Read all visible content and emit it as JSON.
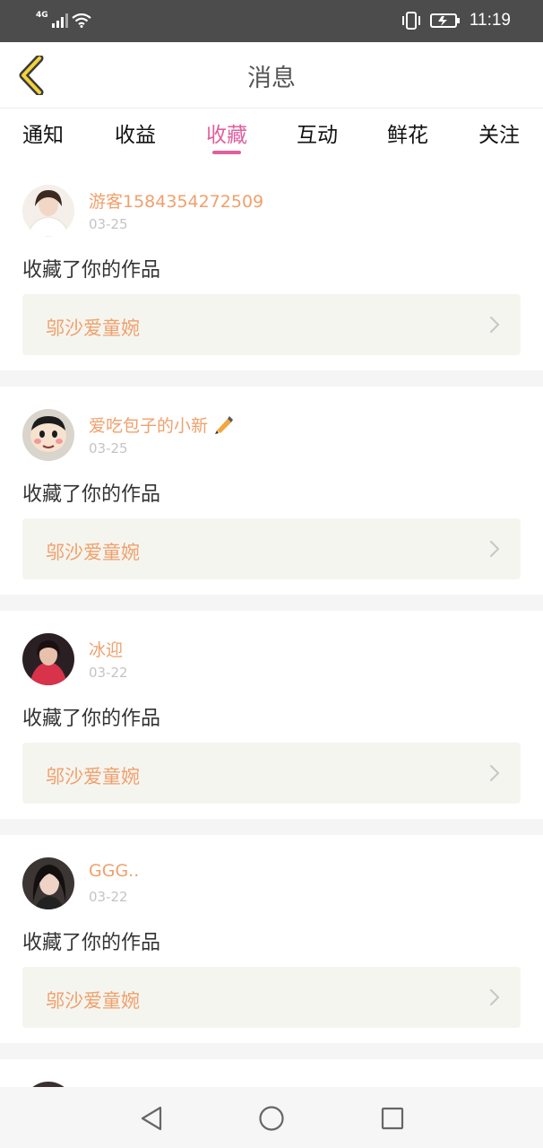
{
  "status_bar": {
    "network_label": "4G",
    "time": "11:19"
  },
  "header": {
    "title": "消息",
    "back_icon": "back-chevron-icon"
  },
  "tabs": [
    {
      "label": "通知",
      "active": false
    },
    {
      "label": "收益",
      "active": false
    },
    {
      "label": "收藏",
      "active": true
    },
    {
      "label": "互动",
      "active": false
    },
    {
      "label": "鲜花",
      "active": false
    },
    {
      "label": "关注",
      "active": false
    }
  ],
  "messages": [
    {
      "user": "游客1584354272509",
      "date": "03-25",
      "action": "收藏了你的作品",
      "work_title": "邬沙爱童婉"
    },
    {
      "user": "爱吃包子的小新",
      "date": "03-25",
      "action": "收藏了你的作品",
      "work_title": "邬沙爱童婉"
    },
    {
      "user": "冰迎",
      "date": "03-22",
      "action": "收藏了你的作品",
      "work_title": "邬沙爱童婉"
    },
    {
      "user": "GGG..",
      "date": "03-22",
      "action": "收藏了你的作品",
      "work_title": "邬沙爱童婉"
    }
  ],
  "colors": {
    "accent": "#e0609e",
    "name_color": "#f0a06c",
    "status_bar_bg": "#4c4c4c",
    "card_link_bg": "#f5f5ef"
  },
  "nav_bar": {
    "back_icon": "nav-back-triangle-icon",
    "home_icon": "nav-home-circle-icon",
    "recents_icon": "nav-recents-square-icon"
  }
}
